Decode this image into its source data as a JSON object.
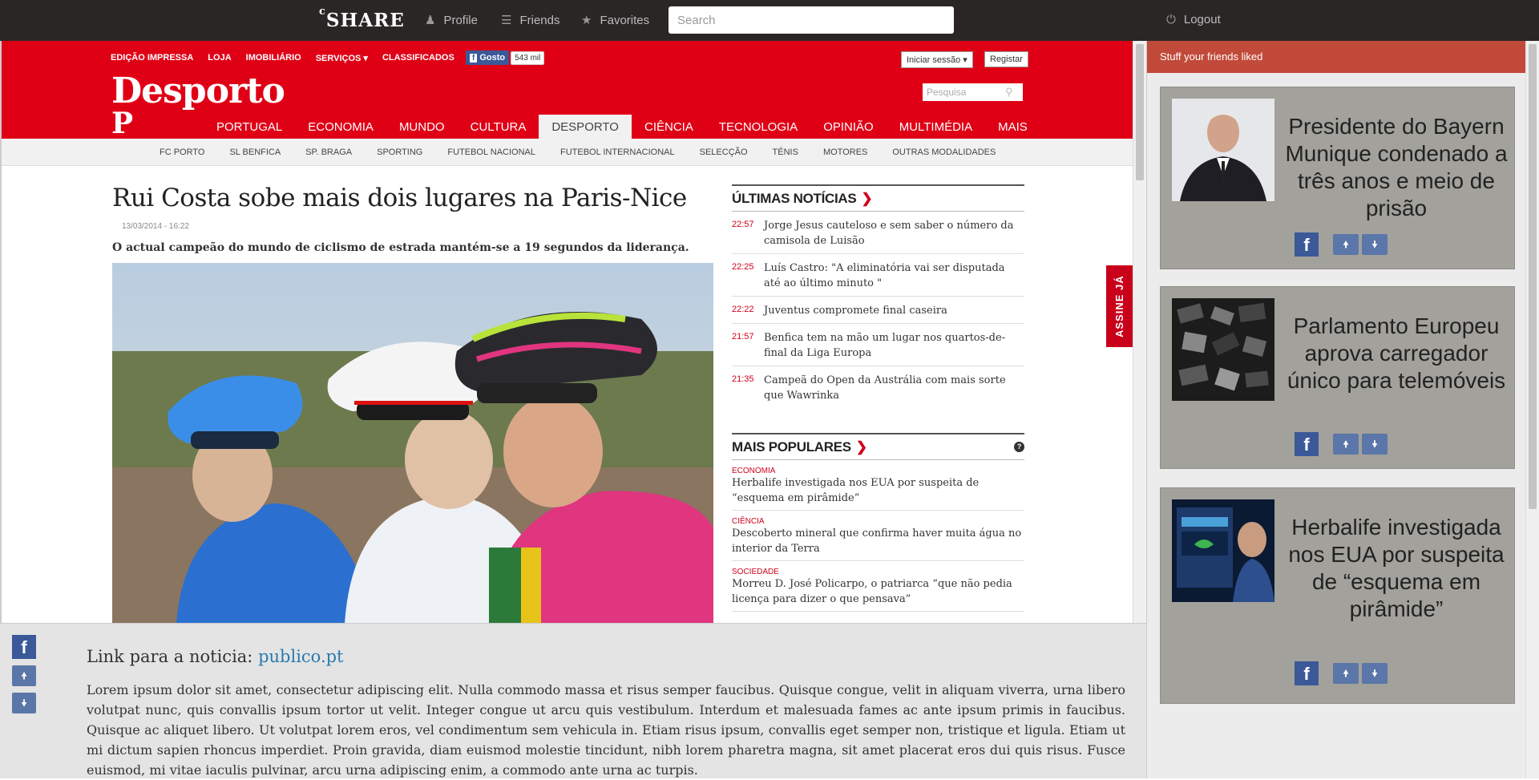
{
  "topbar": {
    "brand_super": "c",
    "brand": "SHARE",
    "profile": "Profile",
    "friends": "Friends",
    "favorites": "Favorites",
    "search_placeholder": "Search",
    "logout": "Logout"
  },
  "site": {
    "util_links": [
      "EDIÇÃO IMPRESSA",
      "LOJA",
      "IMOBILIÁRIO",
      "SERVIÇOS ▾",
      "CLASSIFICADOS"
    ],
    "fb_like": "Gosto",
    "fb_count": "543 mil",
    "login": "Iniciar sessão ▾",
    "register": "Registar",
    "search_placeholder": "Pesquisa",
    "logo": "Desporto",
    "logo_mark": "P",
    "main_nav": [
      "PORTUGAL",
      "ECONOMIA",
      "MUNDO",
      "CULTURA",
      "DESPORTO",
      "CIÊNCIA",
      "TECNOLOGIA",
      "OPINIÃO",
      "MULTIMÉDIA",
      "MAIS"
    ],
    "main_nav_active": "DESPORTO",
    "sub_nav": [
      "FC PORTO",
      "SL BENFICA",
      "SP. BRAGA",
      "SPORTING",
      "FUTEBOL NACIONAL",
      "FUTEBOL INTERNACIONAL",
      "SELECÇÃO",
      "TÉNIS",
      "MOTORES",
      "OUTRAS MODALIDADES"
    ],
    "article": {
      "headline": "Rui Costa sobe mais dois lugares na Paris-Nice",
      "date": "13/03/2014 - 16:22",
      "lead": "O actual campeão do mundo de ciclismo de estrada mantém-se a 19 segundos da liderança."
    },
    "assine": "ASSINE JÁ",
    "latest": {
      "title": "ÚLTIMAS NOTÍCIAS",
      "items": [
        {
          "time": "22:57",
          "text": "Jorge Jesus cauteloso e sem saber o número da camisola de Luisão"
        },
        {
          "time": "22:25",
          "text": "Luís Castro: \"A eliminatória vai ser disputada até ao último minuto \""
        },
        {
          "time": "22:22",
          "text": "Juventus compromete final caseira"
        },
        {
          "time": "21:57",
          "text": "Benfica tem na mão um lugar nos quartos-de-final da Liga Europa"
        },
        {
          "time": "21:35",
          "text": "Campeã do Open da Austrália com mais sorte que Wawrinka"
        }
      ]
    },
    "popular": {
      "title": "MAIS POPULARES",
      "help": "?",
      "items": [
        {
          "cat": "ECONOMIA",
          "text": "Herbalife investigada nos EUA por suspeita de “esquema em pirâmide”"
        },
        {
          "cat": "CIÊNCIA",
          "text": "Descoberto mineral que confirma haver muita água no interior da Terra"
        },
        {
          "cat": "SOCIEDADE",
          "text": "Morreu D. José Policarpo, o patriarca “que não pedia licença para dizer o que pensava”"
        }
      ]
    }
  },
  "friends_panel": {
    "header": "Stuff your friends liked",
    "cards": [
      {
        "title": "Presidente do Bayern Munique condenado a três anos e meio de prisão"
      },
      {
        "title": "Parlamento Europeu aprova carregador único para telemóveis"
      },
      {
        "title": "Herbalife investigada nos EUA por suspeita de “esquema em pirâmide”"
      }
    ]
  },
  "bottom": {
    "link_label": "Link para a noticia:",
    "link_text": "publico.pt",
    "body": "Lorem ipsum dolor sit amet, consectetur adipiscing elit. Nulla commodo massa et risus semper faucibus. Quisque congue, velit in aliquam viverra, urna libero volutpat nunc, quis convallis ipsum tortor ut velit. Integer congue ut arcu quis vestibulum. Interdum et malesuada fames ac ante ipsum primis in faucibus. Quisque ac aliquet libero. Ut volutpat lorem eros, vel condimentum sem vehicula in. Etiam risus ipsum, convallis eget semper non, tristique et ligula. Etiam ut mi dictum sapien rhoncus imperdiet. Proin gravida, diam euismod molestie tincidunt, nibh lorem pharetra magna, sit amet placerat eros dui quis risus. Fusce euismod, mi vitae iaculis pulvinar, arcu urna adipiscing enim, a commodo ante urna ac turpis."
  },
  "colors": {
    "topbar": "#2b2626",
    "publico_red": "#e00016",
    "panel_header": "#c24a3a",
    "facebook": "#3b5998",
    "card_bg": "#a2a19b"
  }
}
